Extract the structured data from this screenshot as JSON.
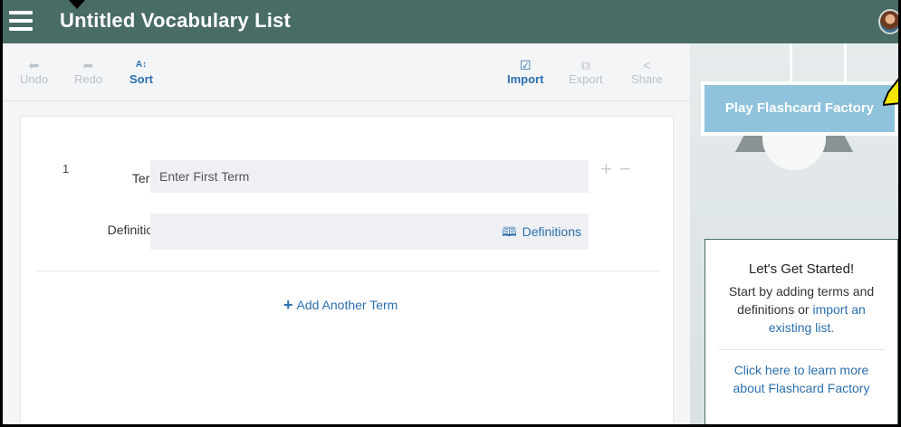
{
  "header": {
    "title": "Untitled Vocabulary List",
    "menu_icon": "hamburger-menu-icon",
    "avatar_icon": "user-avatar"
  },
  "toolbar": {
    "undo": {
      "label": "Undo",
      "icon": "undo-arrow-icon",
      "glyph": "⬅"
    },
    "redo": {
      "label": "Redo",
      "icon": "redo-arrow-icon",
      "glyph": "➦"
    },
    "sort": {
      "label": "Sort",
      "icon": "sort-az-icon",
      "glyph": "A↕"
    },
    "import": {
      "label": "Import",
      "icon": "import-icon",
      "glyph": "☑"
    },
    "export": {
      "label": "Export",
      "icon": "export-icon",
      "glyph": "⧉"
    },
    "share": {
      "label": "Share",
      "icon": "share-icon",
      "glyph": "<"
    }
  },
  "terms": [
    {
      "number": "1",
      "term_label": "Term",
      "term_placeholder": "Enter First Term",
      "definition_label": "Definition",
      "definition_value": "",
      "definitions_link": "Definitions",
      "definitions_icon": "book-search-icon"
    }
  ],
  "add_term": {
    "label": "Add Another Term",
    "icon": "plus-icon"
  },
  "side": {
    "play_button": "Play Flashcard Factory",
    "start_title": "Let's Get Started!",
    "start_text_1": "Start by adding terms and definitions or ",
    "start_link": "import an existing list.",
    "learn_more": "Click here to learn more about Flashcard Factory"
  },
  "colors": {
    "header_bg": "#4a6c67",
    "accent_blue": "#2b6fae",
    "play_button_bg": "#8fc3dd",
    "annotation_yellow": "#f5e600"
  }
}
